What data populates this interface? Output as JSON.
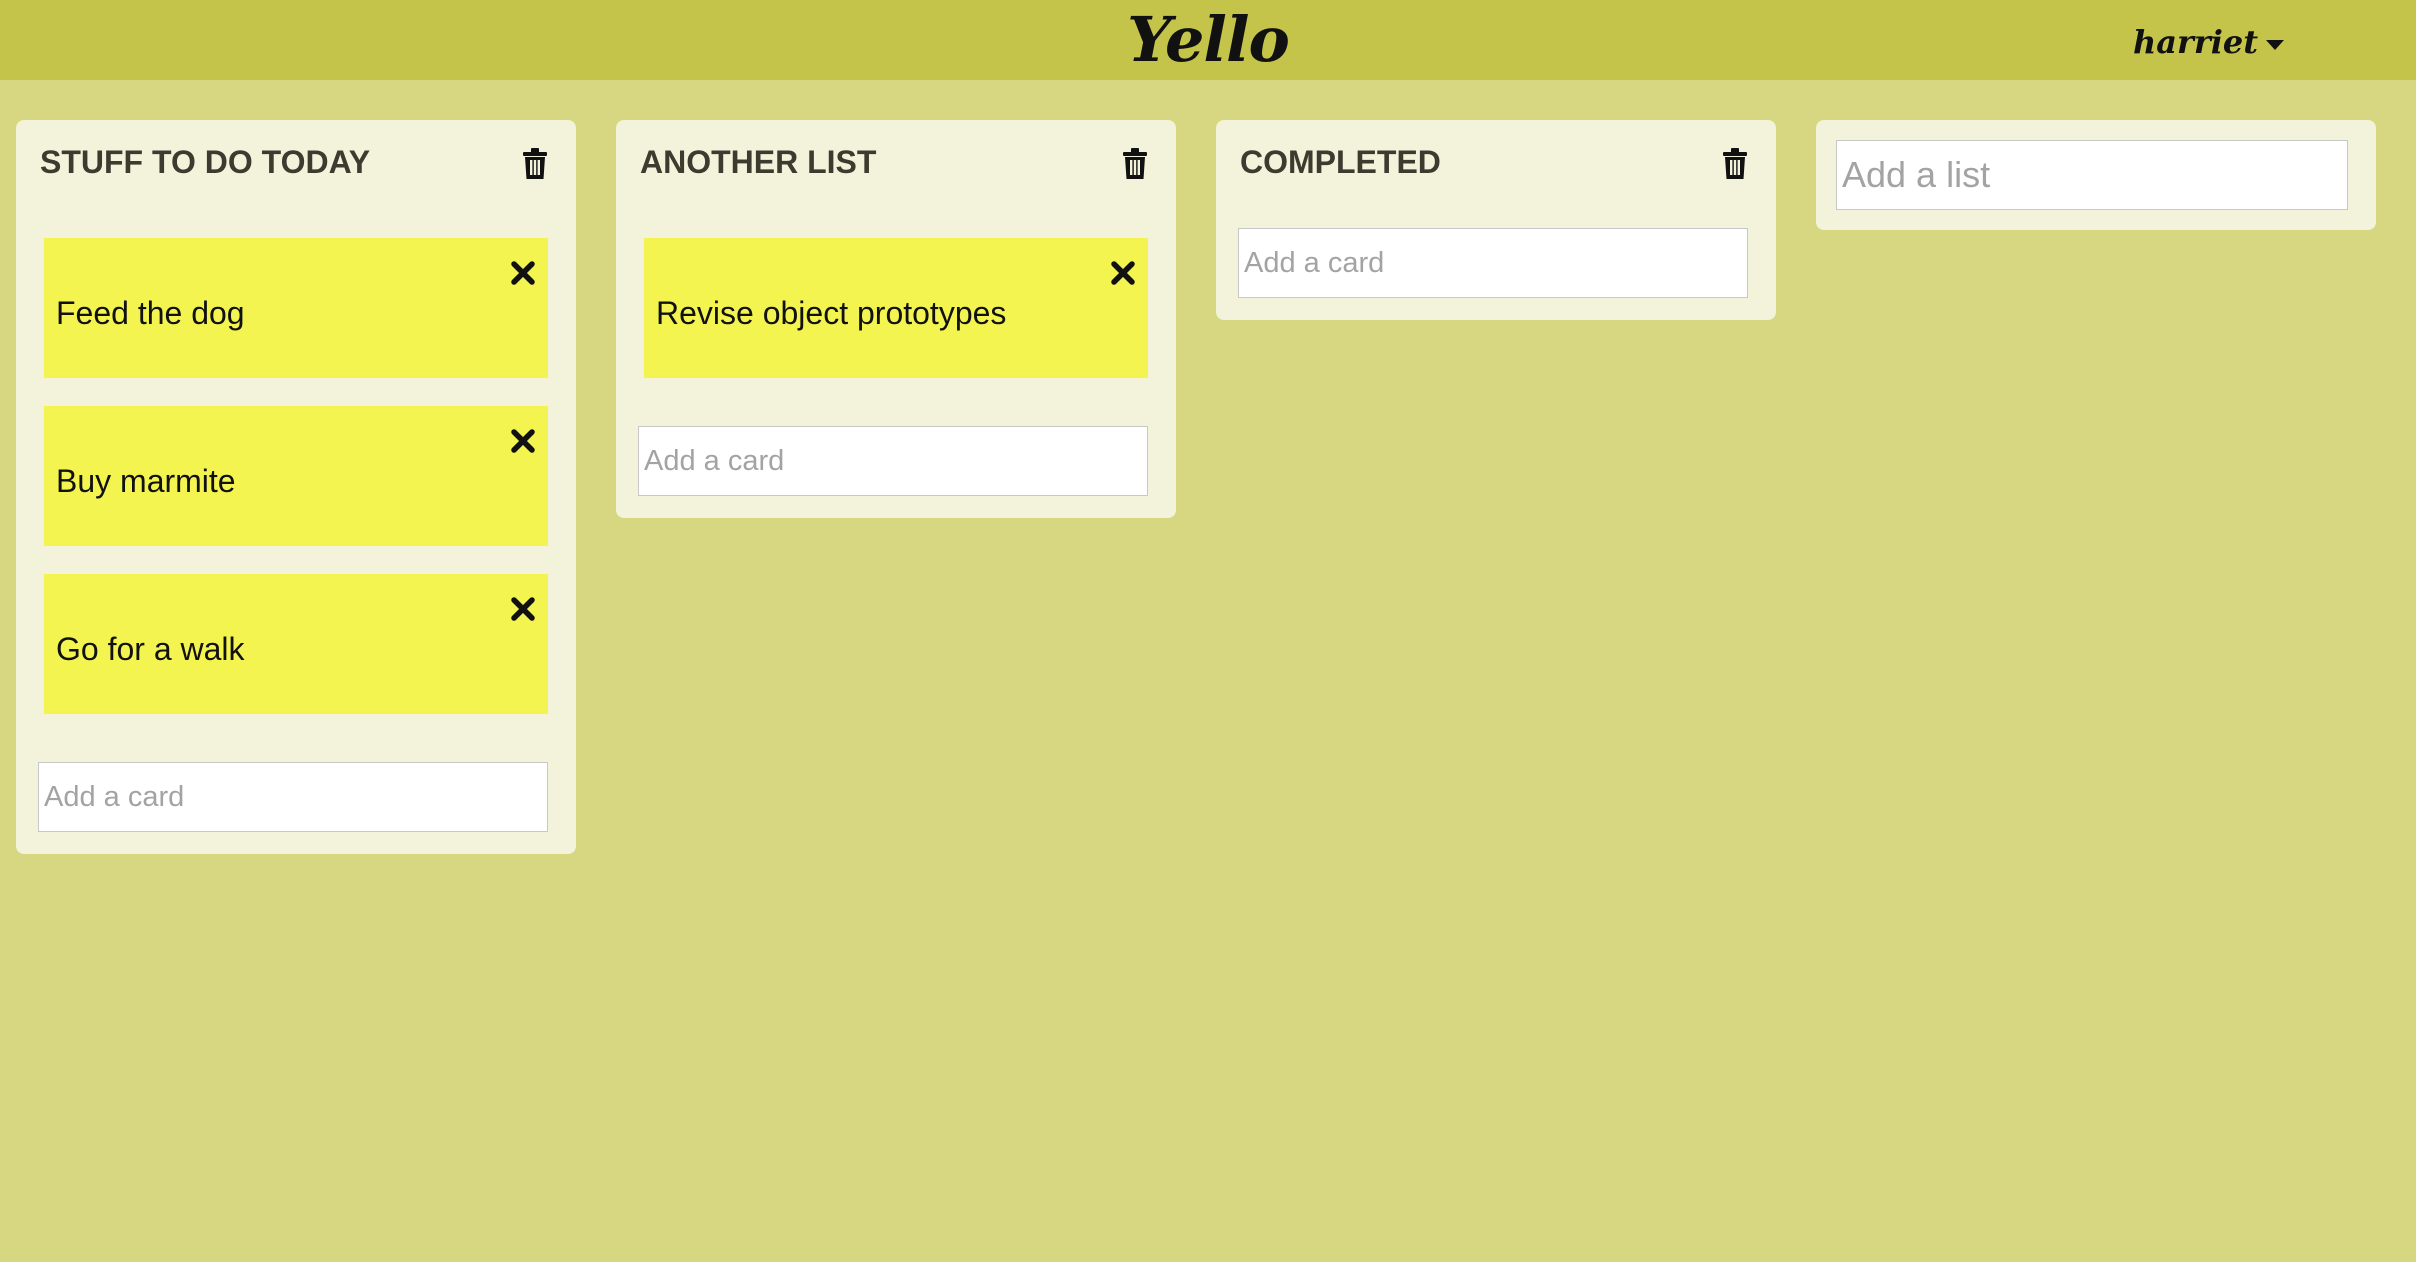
{
  "app": {
    "logo": "Yello",
    "user": "harriet"
  },
  "lists": [
    {
      "title": "STUFF TO DO TODAY",
      "cards": [
        "Feed the dog",
        "Buy marmite",
        "Go for a walk"
      ],
      "add_card_placeholder": "Add a card"
    },
    {
      "title": "ANOTHER LIST",
      "cards": [
        "Revise object prototypes"
      ],
      "add_card_placeholder": "Add a card"
    },
    {
      "title": "COMPLETED",
      "cards": [],
      "add_card_placeholder": "Add a card"
    }
  ],
  "add_list": {
    "placeholder": "Add a list"
  },
  "icons": {
    "delete_list": "trash-icon",
    "delete_card": "close-icon",
    "user_menu": "caret-down-icon"
  },
  "colors": {
    "background": "#d7d782",
    "topbar": "#c4c44b",
    "list": "#f3f3dc",
    "card": "#f4f450"
  }
}
